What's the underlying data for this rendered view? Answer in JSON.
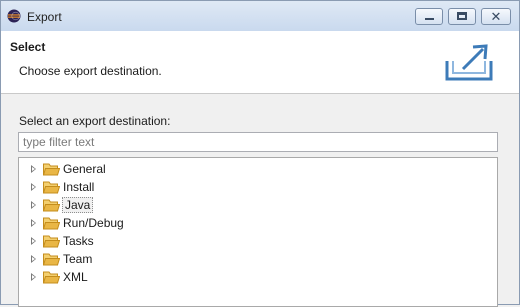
{
  "window": {
    "title": "Export"
  },
  "header": {
    "title": "Select",
    "description": "Choose export destination."
  },
  "main": {
    "label": "Select an export destination:",
    "filter": {
      "placeholder": "type filter text",
      "value": ""
    },
    "tree_items": [
      {
        "label": "General",
        "selected": false
      },
      {
        "label": "Install",
        "selected": false
      },
      {
        "label": "Java",
        "selected": true
      },
      {
        "label": "Run/Debug",
        "selected": false
      },
      {
        "label": "Tasks",
        "selected": false
      },
      {
        "label": "Team",
        "selected": false
      },
      {
        "label": "XML",
        "selected": false
      }
    ]
  },
  "colors": {
    "folder": "#e9b645",
    "folder_dark": "#c48d1d",
    "title_bar": "#c9d9ee",
    "export_graphic": "#3d7bb8"
  },
  "icons": {
    "app": "eclipse-icon",
    "folder": "folder-icon",
    "expand": "expand-triangle-icon",
    "export": "export-wizard-graphic"
  }
}
